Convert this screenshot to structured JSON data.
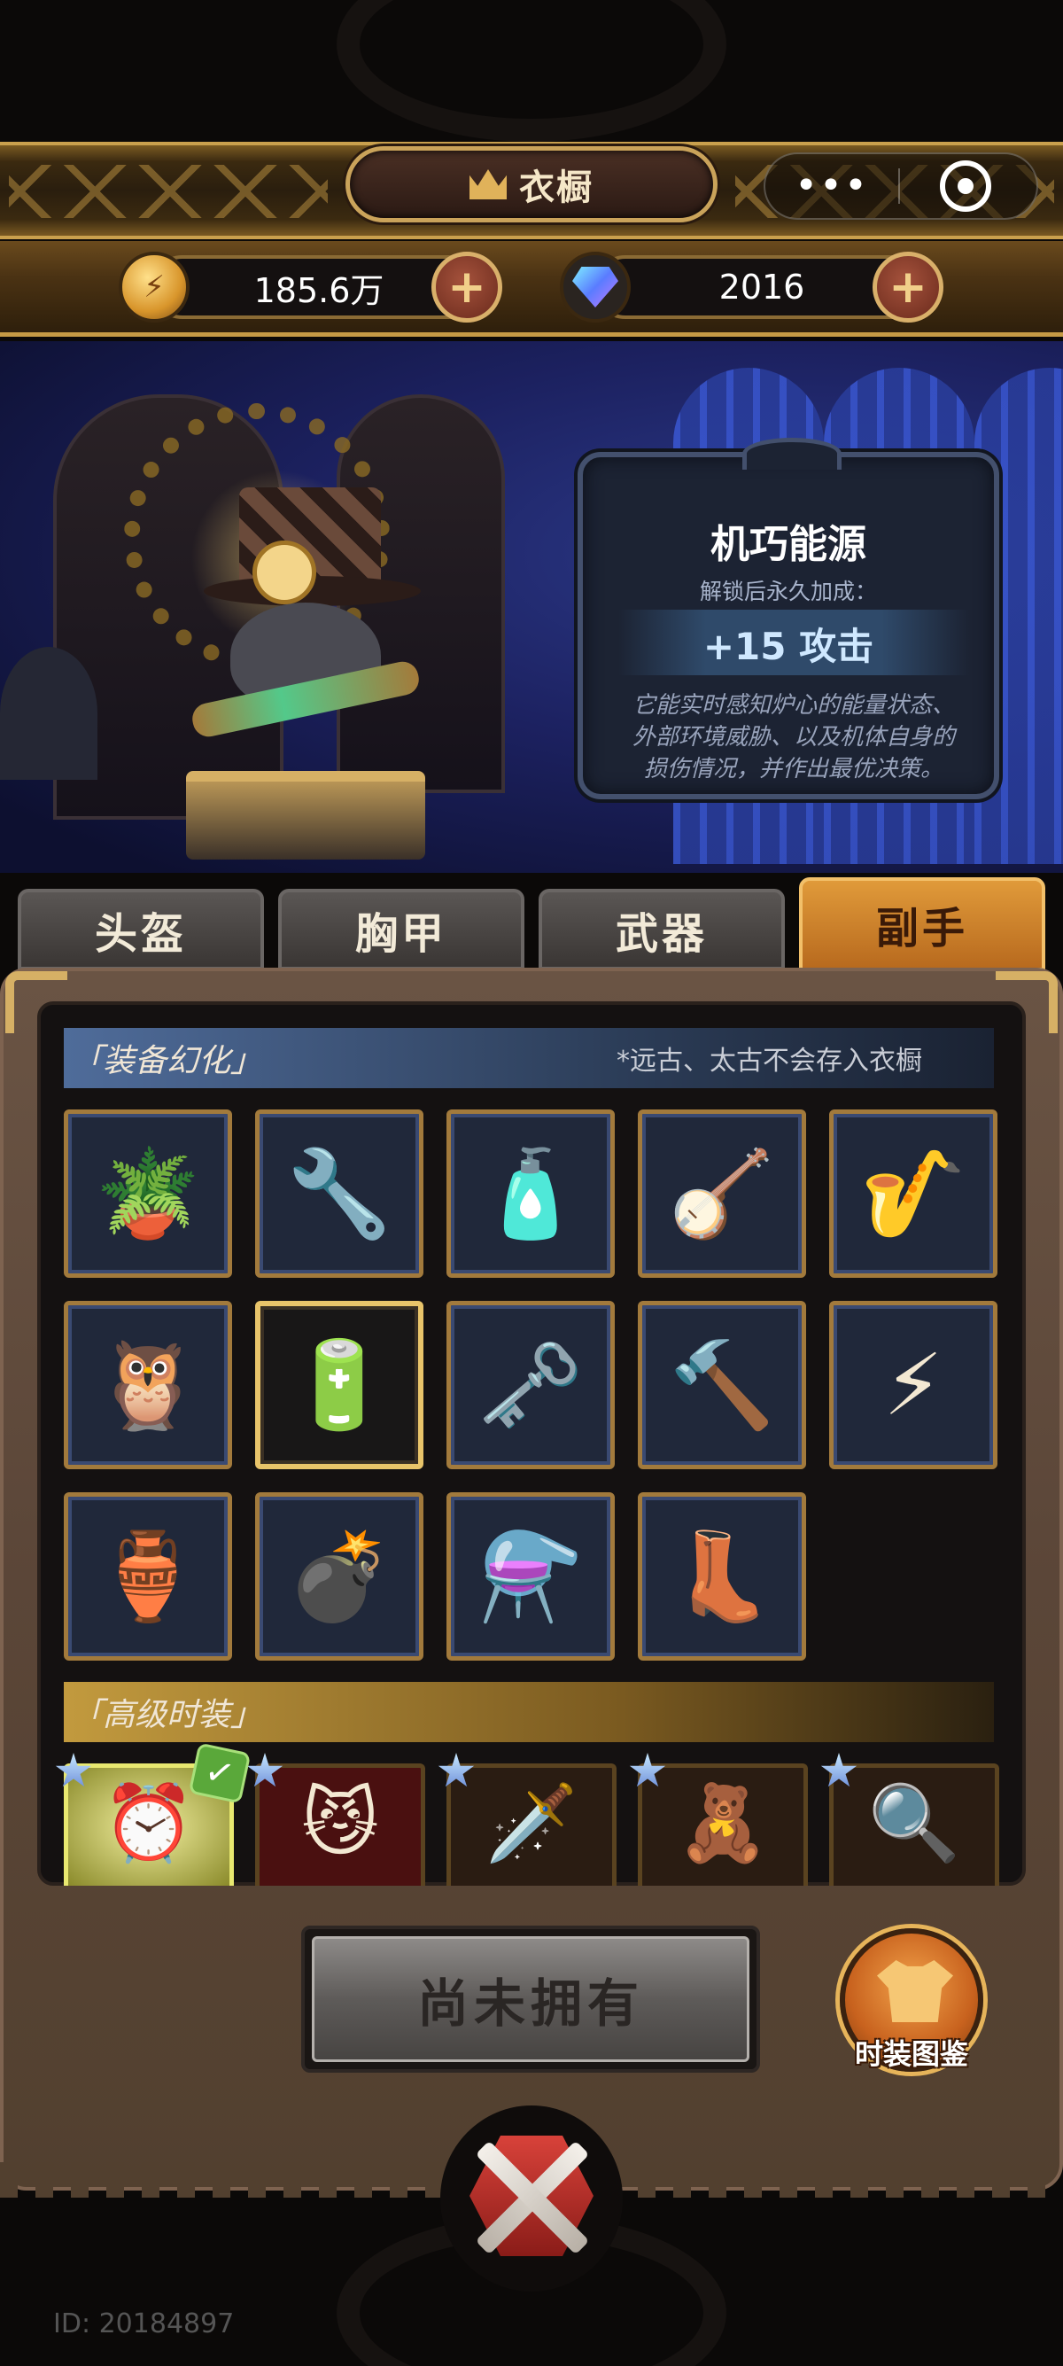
{
  "header": {
    "title": "衣橱",
    "more_icon": "•••",
    "target_icon": "target-icon"
  },
  "currency": {
    "gold": "185.6万",
    "gems": "2016",
    "add_label": "+"
  },
  "info": {
    "name": "机巧能源",
    "subtitle": "解锁后永久加成：",
    "bonus": "+15 攻击",
    "desc_line1": "它能实时感知炉心的能量状态、",
    "desc_line2": "外部环境威胁、以及机体自身的",
    "desc_line3": "损伤情况，并作出最优决策。"
  },
  "tabs": [
    {
      "label": "头盔"
    },
    {
      "label": "胸甲"
    },
    {
      "label": "武器"
    },
    {
      "label": "副手",
      "active": true
    }
  ],
  "sections": {
    "transform": {
      "title": "「装备幻化」",
      "note": "*远古、太古不会存入衣橱"
    },
    "fashion": {
      "title": "「高级时装」"
    }
  },
  "items": [
    {
      "icon": "potted-plant-icon",
      "glyph": "🪴"
    },
    {
      "icon": "wrench-icon",
      "glyph": "🔧"
    },
    {
      "icon": "bottle-icon",
      "glyph": "🧴"
    },
    {
      "icon": "lute-icon",
      "glyph": "🪕"
    },
    {
      "icon": "saxophone-icon",
      "glyph": "🎷"
    },
    {
      "icon": "owl-robot-icon",
      "glyph": "🦉"
    },
    {
      "icon": "energy-canister-icon",
      "glyph": "🔋",
      "selected": true
    },
    {
      "icon": "wind-up-key-icon",
      "glyph": "🗝️"
    },
    {
      "icon": "hammer-icon",
      "glyph": "🔨"
    },
    {
      "icon": "tesla-coil-icon",
      "glyph": "⚡"
    },
    {
      "icon": "spiked-vase-icon",
      "glyph": "🏺"
    },
    {
      "icon": "bomb-icon",
      "glyph": "💣"
    },
    {
      "icon": "potion-icon",
      "glyph": "⚗️"
    },
    {
      "icon": "boots-icon",
      "glyph": "👢"
    }
  ],
  "fashion_items": [
    {
      "icon": "alarm-clock-icon",
      "glyph": "⏰",
      "equipped": true
    },
    {
      "icon": "cat-mask-icon",
      "glyph": "😼"
    },
    {
      "icon": "spear-icon",
      "glyph": "🗡️"
    },
    {
      "icon": "bear-balloon-icon",
      "glyph": "🧸"
    },
    {
      "icon": "magnifier-icon",
      "glyph": "🔍"
    }
  ],
  "buttons": {
    "not_owned": "尚未拥有",
    "codex": "时装图鉴"
  },
  "footer": {
    "id": "ID: 20184897"
  },
  "colors": {
    "accent_gold": "#c9a04d",
    "tab_active": "#d98a2c",
    "panel_bg": "#5b4638",
    "info_bg": "#1c2333"
  }
}
